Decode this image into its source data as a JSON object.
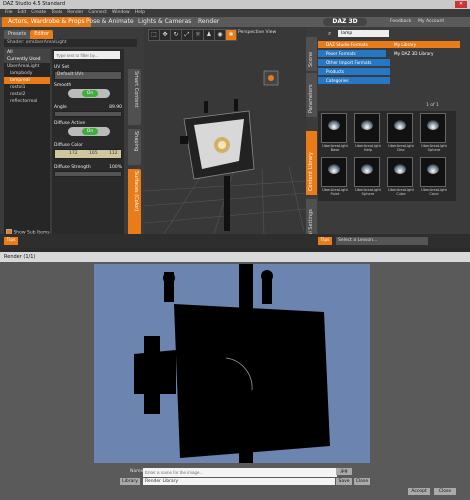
{
  "app": {
    "title": "DAZ Studio 4.5 Standard",
    "menus": [
      "File",
      "Edit",
      "Create",
      "Tools",
      "Render",
      "Connect",
      "Window",
      "Help"
    ],
    "tabs": [
      "Actors, Wardrobe & Props",
      "Pose & Animate",
      "Lights & Cameras",
      "Render"
    ],
    "logo": "DAZ 3D",
    "links": [
      "Feedback",
      "My Account"
    ]
  },
  "left_panel": {
    "tabs": [
      "Presets",
      "Editor"
    ],
    "config_label": "Shader: omUberArealLight",
    "tree": [
      "All",
      "Currently Used",
      "UberAreaLight",
      "lampbody",
      "lampreal",
      "rostol1",
      "rostol2",
      "reflectorreal"
    ],
    "filter_placeholder": "Type text to filter by...",
    "side_tabs": [
      "Smart Content",
      "Shaping",
      "Surfaces (Color)"
    ],
    "show_sub_items": "Show Sub Items",
    "props": {
      "uv_set": {
        "label": "UV Set",
        "value": "Default UVs"
      },
      "smooth": {
        "label": "Smooth",
        "value": "On"
      },
      "angle": {
        "label": "Angle",
        "value": "89.90"
      },
      "diffuse_active": {
        "label": "Diffuse Active",
        "value": "On"
      },
      "diffuse_color": {
        "label": "Diffuse Color",
        "r": "172",
        "g": "165",
        "b": "112"
      },
      "diffuse_strength": {
        "label": "Diffuse Strength",
        "value": "100%"
      }
    },
    "tips": "Tips"
  },
  "viewport": {
    "camera": "Perspective View",
    "tool_icons": [
      "select-icon",
      "move-icon",
      "rotate-icon",
      "scale-icon",
      "light-icon",
      "pose-icon",
      "camera-icon",
      "settings-icon"
    ]
  },
  "right_panel": {
    "side_tabs": [
      "Scene",
      "Parameters",
      "Content Library",
      "Tool Settings"
    ],
    "search_value": "lamp",
    "folders_left": [
      "DAZ Studio Formats",
      "Poser Formats",
      "Other Import Formats",
      "Products",
      "Categories"
    ],
    "folders_right": [
      "My Library",
      "My DAZ 3D Library"
    ],
    "page_label": "1 of 1",
    "thumbs": [
      "UberAreaLight Base",
      "UberAreaLight Help",
      "UberAreaLight Disc",
      "UberAreaLight Sphere",
      "UberAreaLight Point",
      "UberAreaLight Sphere",
      "UberAreaLight Cube",
      "UberAreaLight Cone"
    ],
    "bottom_tabs": [
      "Tips",
      "Info",
      "Tags"
    ],
    "lesson_select": "Select a Lesson..."
  },
  "render_window": {
    "title": "Render (1/1)",
    "name_label": "Name",
    "name_placeholder": "Enter a name for the image...",
    "format": "jpg",
    "library_select": "Library",
    "library_value": "Render Library",
    "buttons": [
      "Save",
      "Close",
      "Accept",
      "Close"
    ]
  },
  "colors": {
    "accent": "#e97b18",
    "bg": "#3b3b3b",
    "render_bg": "#6b84b0"
  }
}
